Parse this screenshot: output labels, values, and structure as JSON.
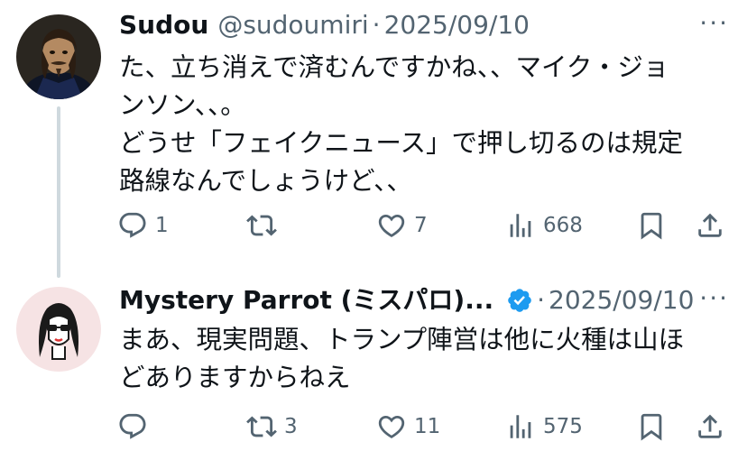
{
  "tweets": [
    {
      "name": "Sudou",
      "handle": "@sudoumiri",
      "separator": "·",
      "date": "2025/09/10",
      "more": "···",
      "lines": [
        "た、立ち消えで済むんですかね、、マイク・ジョ",
        "ンソン、、。",
        "どうせ「フェイクニュース」で押し切るのは規定",
        "路線なんでしょうけど、、"
      ],
      "stats": {
        "replies": "1",
        "reposts": "",
        "likes": "7",
        "views": "668"
      },
      "icons": [
        "reply-icon",
        "repost-icon",
        "like-icon",
        "views-icon",
        "bookmark-icon",
        "share-icon"
      ]
    },
    {
      "name": "Mystery Parrot (ミスパロ)...",
      "handle": "",
      "separator": "·",
      "date": "2025/09/10",
      "more": "···",
      "verified": true,
      "lines": [
        "まあ、現実問題、トランプ陣営は他に火種は山ほ",
        "どありますからねえ"
      ],
      "stats": {
        "replies": "",
        "reposts": "3",
        "likes": "11",
        "views": "575"
      },
      "icons": [
        "reply-icon",
        "repost-icon",
        "like-icon",
        "views-icon",
        "bookmark-icon",
        "share-icon"
      ]
    }
  ],
  "colors": {
    "text": "#0f1419",
    "muted": "#536471",
    "verified": "#1d9bf0",
    "thread_line": "#cfd9de"
  }
}
